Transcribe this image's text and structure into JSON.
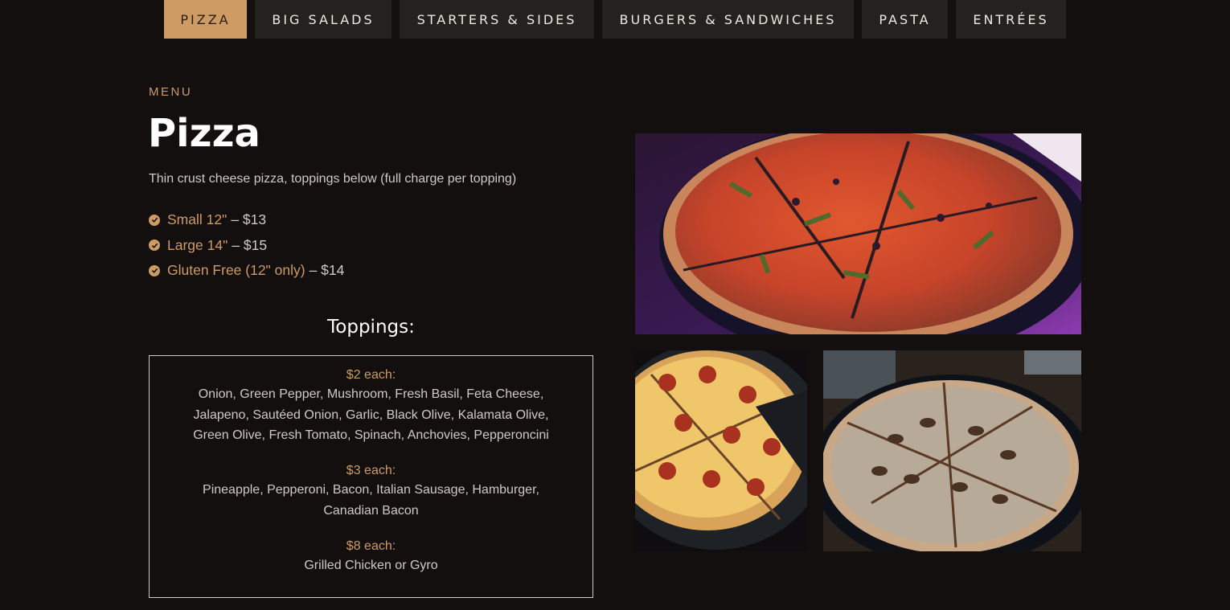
{
  "nav": {
    "tabs": [
      {
        "label": "PIZZA",
        "active": true
      },
      {
        "label": "BIG SALADS",
        "active": false
      },
      {
        "label": "STARTERS & SIDES",
        "active": false
      },
      {
        "label": "BURGERS & SANDWICHES",
        "active": false
      },
      {
        "label": "PASTA",
        "active": false
      },
      {
        "label": "ENTRÉES",
        "active": false
      }
    ]
  },
  "section": {
    "eyebrow": "MENU",
    "title": "Pizza",
    "description": "Thin crust cheese pizza, toppings below (full charge per topping)"
  },
  "sizes": [
    {
      "name": "Small 12\"",
      "price": "– $13"
    },
    {
      "name": "Large 14\"",
      "price": "– $15"
    },
    {
      "name": "Gluten Free (12\" only)",
      "price": "– $14"
    }
  ],
  "toppings": {
    "heading": "Toppings:",
    "tiers": [
      {
        "label": "$2 each:",
        "items": "Onion, Green Pepper, Mushroom, Fresh Basil, Feta Cheese, Jalapeno, Sautéed Onion, Garlic, Black Olive, Kalamata Olive, Green Olive, Fresh Tomato, Spinach, Anchovies, Pepperoncini"
      },
      {
        "label": "$3 each:",
        "items": "Pineapple, Pepperoni, Bacon, Italian Sausage, Hamburger, Canadian Bacon"
      },
      {
        "label": "$8 each:",
        "items": "Grilled Chicken or Gyro"
      }
    ]
  },
  "colors": {
    "accent": "#cd9b63",
    "background": "#120f0e",
    "tab_bg": "#25211f"
  }
}
